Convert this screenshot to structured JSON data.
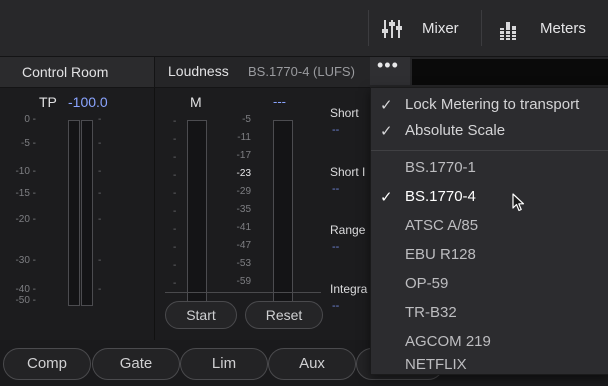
{
  "topbar": {
    "mixer_label": "Mixer",
    "meters_label": "Meters"
  },
  "header": {
    "control_room_title": "Control Room",
    "loudness_title": "Loudness",
    "loudness_standard": "BS.1770-4 (LUFS)",
    "more_label": "•••"
  },
  "control_room": {
    "tp_label": "TP",
    "tp_value": "-100.0",
    "scale": [
      "0 -",
      "-5 -",
      "-10 -",
      "-15 -",
      "-20 -",
      "-30 -",
      "-40 -",
      "-50 -"
    ]
  },
  "loudness": {
    "m_label": "M",
    "m_value": "---",
    "scale_values": [
      "-5",
      "-11",
      "-17",
      "-23",
      "-29",
      "-35",
      "-41",
      "-47",
      "-53",
      "-59"
    ],
    "start_label": "Start",
    "reset_label": "Reset",
    "short_label": "Short",
    "short_value": "--",
    "short_i_label": "Short I",
    "short_i_value": "--",
    "range_label": "Range",
    "range_value": "--",
    "integrated_label": "Integra",
    "integrated_value": "--"
  },
  "bottom_tabs": {
    "comp": "Comp",
    "gate": "Gate",
    "lim": "Lim",
    "aux": "Aux"
  },
  "menu": {
    "lock_metering": "Lock Metering to transport",
    "absolute_scale": "Absolute Scale",
    "standards": [
      {
        "label": "BS.1770-1",
        "checked": false
      },
      {
        "label": "BS.1770-4",
        "checked": true
      },
      {
        "label": "ATSC A/85",
        "checked": false
      },
      {
        "label": "EBU R128",
        "checked": false
      },
      {
        "label": "OP-59",
        "checked": false
      },
      {
        "label": "TR-B32",
        "checked": false
      },
      {
        "label": "AGCOM 219",
        "checked": false
      },
      {
        "label": "NETFLIX",
        "checked": false
      }
    ],
    "check_glyph": "✓"
  },
  "colors": {
    "accent_blue": "#8aa4ff",
    "background": "#1f1f21"
  }
}
